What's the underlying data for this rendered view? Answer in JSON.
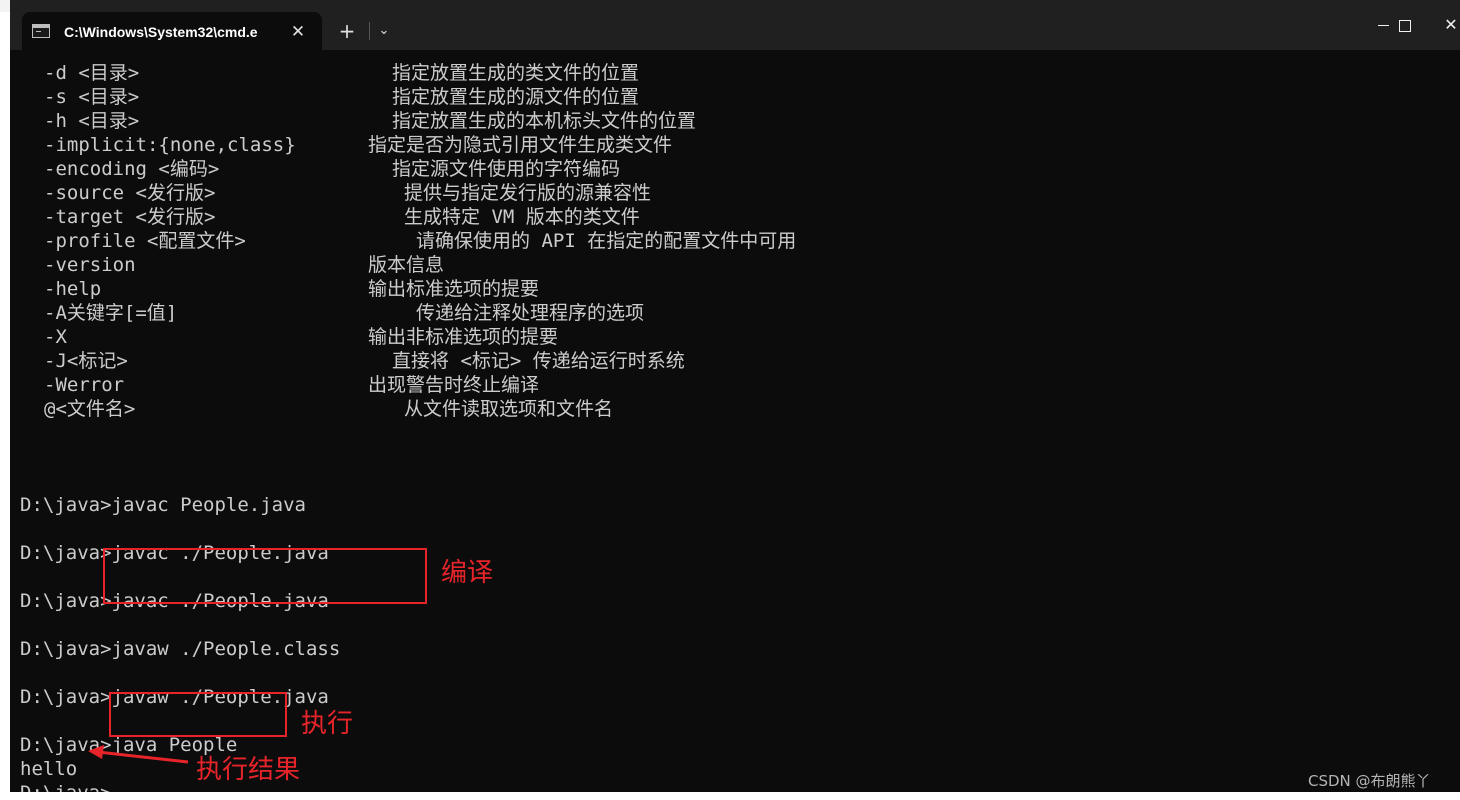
{
  "window": {
    "tab_title": "C:\\Windows\\System32\\cmd.e",
    "close_tab_glyph": "✕",
    "new_tab_glyph": "+",
    "dropdown_glyph": "⌄",
    "minimize_glyph": "—",
    "maximize_glyph": "☐",
    "close_glyph": "✕"
  },
  "options": [
    {
      "opt": "-d <目录>",
      "desc": "指定放置生成的类文件的位置"
    },
    {
      "opt": "-s <目录>",
      "desc": "指定放置生成的源文件的位置"
    },
    {
      "opt": "-h <目录>",
      "desc": "指定放置生成的本机标头文件的位置"
    },
    {
      "opt": "-implicit:{none,class}",
      "desc": "指定是否为隐式引用文件生成类文件"
    },
    {
      "opt": "-encoding <编码>",
      "desc": "指定源文件使用的字符编码"
    },
    {
      "opt": "-source <发行版>",
      "desc": "提供与指定发行版的源兼容性"
    },
    {
      "opt": "-target <发行版>",
      "desc": "生成特定 VM 版本的类文件"
    },
    {
      "opt": "-profile <配置文件>",
      "desc": "请确保使用的 API 在指定的配置文件中可用"
    },
    {
      "opt": "-version",
      "desc": "版本信息"
    },
    {
      "opt": "-help",
      "desc": "输出标准选项的提要"
    },
    {
      "opt": "-A关键字[=值]",
      "desc": "传递给注释处理程序的选项"
    },
    {
      "opt": "-X",
      "desc": "输出非标准选项的提要"
    },
    {
      "opt": "-J<标记>",
      "desc": "直接将 <标记> 传递给运行时系统"
    },
    {
      "opt": "-Werror",
      "desc": "出现警告时终止编译"
    },
    {
      "opt": "@<文件名>",
      "desc": "从文件读取选项和文件名"
    }
  ],
  "commands": [
    "D:\\java>javac People.java",
    "D:\\java>javac ./People.java",
    "D:\\java>javac ./People.java",
    "D:\\java>javaw ./People.class",
    "D:\\java>javaw ./People.java",
    "D:\\java>java People",
    "hello",
    "D:\\java>"
  ],
  "annotations": {
    "compile": "编译",
    "execute": "执行",
    "result": "执行结果",
    "color": "#e8242b"
  },
  "watermark": "CSDN @布朗熊丫"
}
